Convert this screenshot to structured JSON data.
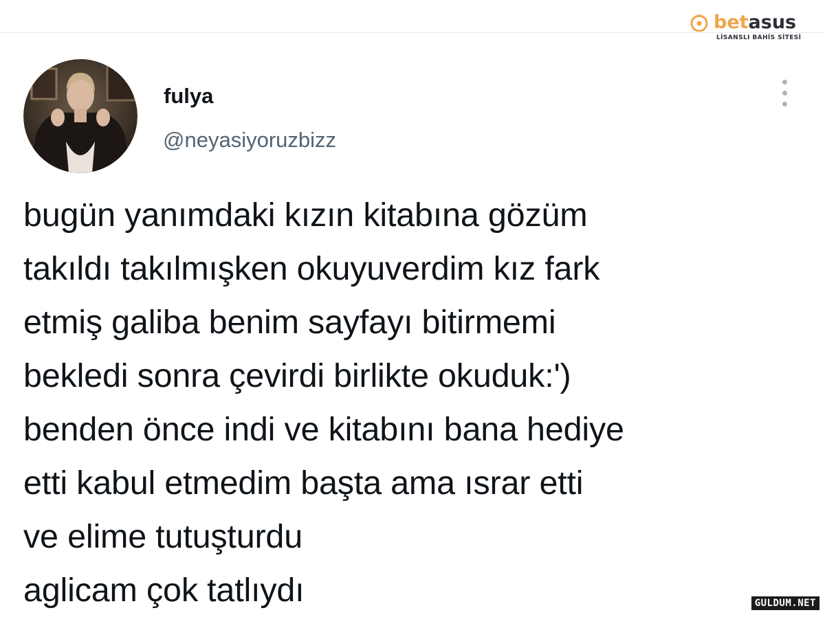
{
  "watermark": {
    "brand_part1": "bet",
    "brand_part2": "asus",
    "brand_subtitle": "LİSANSLI BAHİS SİTESİ",
    "brand_color": "#f0a64a",
    "corner_text": "GULDUM.NET"
  },
  "tweet": {
    "display_name": "fulya",
    "handle": "@neyasiyoruzbizz",
    "more_icon": "more-vertical-icon",
    "lines": [
      "bugün yanımdaki kızın kitabına gözüm",
      "takıldı takılmışken okuyuverdim kız fark",
      "etmiş galiba benim sayfayı bitirmemi",
      "bekledi sonra çevirdi birlikte okuduk:')",
      "benden önce indi ve kitabını bana hediye",
      "etti kabul etmedim başta ama ısrar etti",
      "ve elime tutuşturdu",
      "aglicam çok tatlıydı"
    ]
  }
}
